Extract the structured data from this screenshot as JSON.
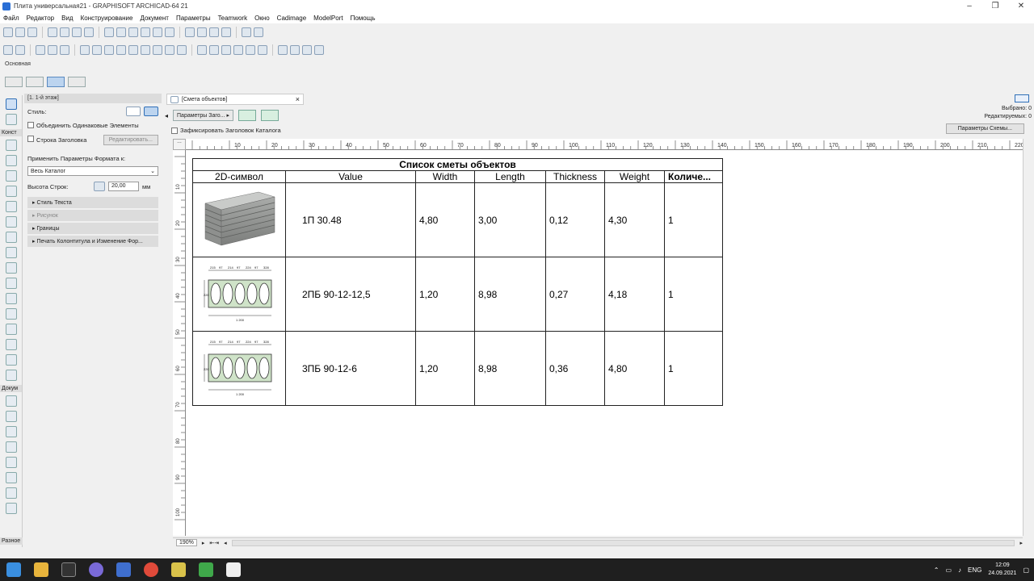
{
  "window": {
    "title": "Плита универсальная21 - GRAPHISOFT ARCHICAD-64 21",
    "minimize": "–",
    "maximize": "❐",
    "close": "✕"
  },
  "menu": [
    "Файл",
    "Редактор",
    "Вид",
    "Конструирование",
    "Документ",
    "Параметры",
    "Teamwork",
    "Окно",
    "Cadimage",
    "ModelPort",
    "Помощь"
  ],
  "toolbar_label": "Основная",
  "toolbox": {
    "construct_label": "Конст",
    "document_label": "Докум",
    "misc_label": "Разное"
  },
  "left_panel": {
    "header": "[1. 1-й этаж]",
    "style_label": "Стиль:",
    "merge_label": "Объединить Одинаковые Элементы",
    "header_row_label": "Строка Заголовка",
    "edit_button": "Редактировать...",
    "apply_label": "Применить Параметры Формата к:",
    "apply_value": "Весь Каталог",
    "row_height_label": "Высота Строк:",
    "row_height_value": "20,00",
    "row_height_unit": "мм",
    "sections": [
      "Стиль Текста",
      "Рисунок",
      "Границы",
      "Печать Колонтитула и Изменение Фор..."
    ]
  },
  "tab": {
    "label": "[Смета объектов]",
    "close": "×"
  },
  "header_params_button": "Параметры Заго...",
  "fix_header_label": "Зафиксировать Заголовок Каталога",
  "status_right": {
    "selected_label": "Выбрано:",
    "selected_value": "0",
    "editable_label": "Редактируемых:",
    "editable_value": "0"
  },
  "schema_button": "Параметры Схемы...",
  "ruler": {
    "h_ticks": [
      "10",
      "20",
      "30",
      "40",
      "50",
      "60",
      "70",
      "80",
      "90",
      "100",
      "110",
      "120",
      "130",
      "140",
      "150",
      "160",
      "170",
      "180",
      "190",
      "200",
      "210",
      "220"
    ],
    "v_ticks": [
      "10",
      "20",
      "30",
      "40",
      "50",
      "60",
      "70",
      "80",
      "90",
      "100"
    ]
  },
  "schedule": {
    "caption": "Список сметы объектов",
    "columns": [
      "2D-символ",
      "Value",
      "Width",
      "Length",
      "Thickness",
      "Weight",
      "Количе..."
    ],
    "rows": [
      {
        "symbol": "stacked-slabs-image",
        "value": "1П 30.48",
        "width": "4,80",
        "length": "3,00",
        "thickness": "0,12",
        "weight": "4,30",
        "qty": "1"
      },
      {
        "symbol": "hollow-core-section",
        "value": "2ПБ 90-12-12,5",
        "width": "1,20",
        "length": "8,98",
        "thickness": "0,27",
        "weight": "4,18",
        "qty": "1"
      },
      {
        "symbol": "hollow-core-section",
        "value": "3ПБ 90-12-6",
        "width": "1,20",
        "length": "8,98",
        "thickness": "0,36",
        "weight": "4,80",
        "qty": "1"
      }
    ],
    "section_dims": {
      "top": [
        "215",
        "97",
        "214",
        "97",
        "224",
        "97",
        "328"
      ],
      "bottom": "1 200",
      "side": "220"
    }
  },
  "statusbar": {
    "zoom": "190%"
  },
  "taskbar": {
    "lang": "ENG",
    "time": "12:09",
    "date": "24.09.2021"
  },
  "colors": {
    "accent": "#2f6fb7",
    "taskbar": "#1f1f1f"
  }
}
